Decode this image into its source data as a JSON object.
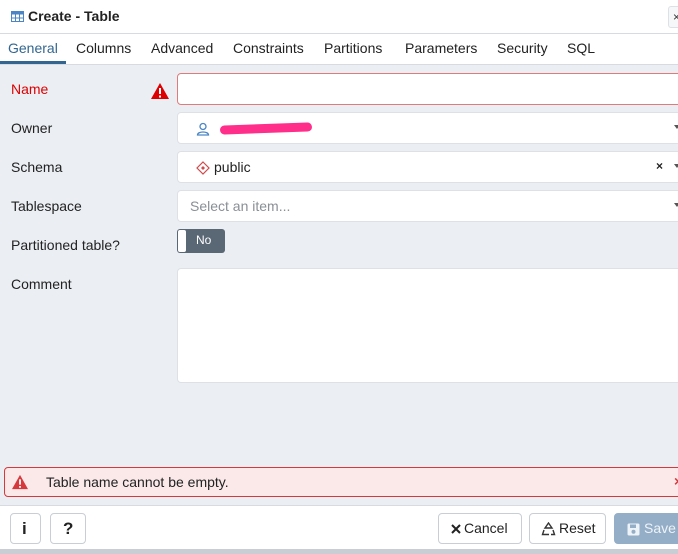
{
  "title": "Create - Table",
  "title_close": "×",
  "tabs": [
    {
      "label": "General",
      "active": true
    },
    {
      "label": "Columns"
    },
    {
      "label": "Advanced"
    },
    {
      "label": "Constraints"
    },
    {
      "label": "Partitions"
    },
    {
      "label": "Parameters"
    },
    {
      "label": "Security"
    },
    {
      "label": "SQL"
    }
  ],
  "form": {
    "name": {
      "label": "Name",
      "value": "",
      "error": true
    },
    "owner": {
      "label": "Owner",
      "value": ""
    },
    "schema": {
      "label": "Schema",
      "value": "public",
      "clear": "×"
    },
    "tablespace": {
      "label": "Tablespace",
      "placeholder": "Select an item..."
    },
    "partitioned": {
      "label": "Partitioned table?",
      "value": "No"
    },
    "comment": {
      "label": "Comment",
      "value": ""
    }
  },
  "alert": {
    "message": "Table name cannot be empty.",
    "close": "×"
  },
  "footer": {
    "info": "i",
    "help": "?",
    "cancel": "Cancel",
    "reset": "Reset",
    "save": "Save"
  },
  "colors": {
    "accent": "#326690",
    "error": "#dd0000",
    "alert_bg": "#fbe9ea",
    "toggle_off": "#5a6775",
    "save_disabled": "#93aec6"
  },
  "icons": {
    "title": "table-icon",
    "error": "warning-triangle-icon",
    "owner": "user-icon",
    "schema": "schema-diamond-icon"
  }
}
